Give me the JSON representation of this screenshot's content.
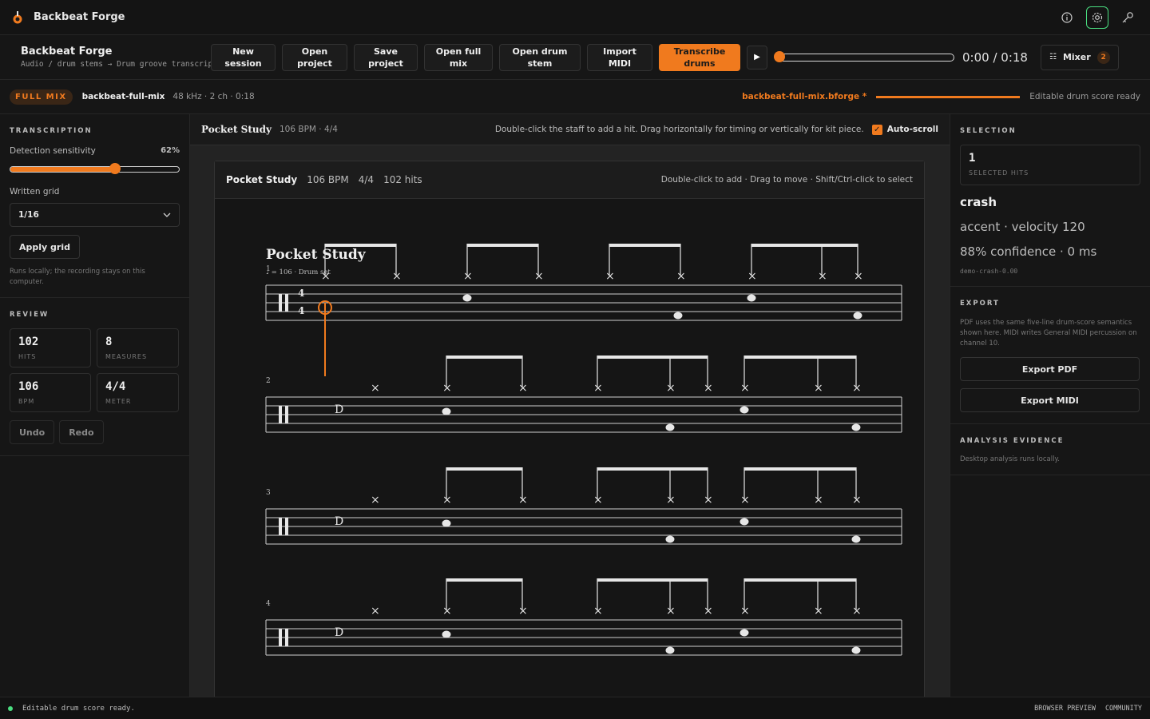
{
  "titlebar": {
    "title": "Backbeat Forge"
  },
  "toolbar": {
    "brand_name": "Backbeat Forge",
    "brand_sub": "Audio / drum stems → Drum groove transcription",
    "buttons": [
      {
        "l1": "New",
        "l2": "session"
      },
      {
        "l1": "Open",
        "l2": "project"
      },
      {
        "l1": "Save",
        "l2": "project"
      },
      {
        "l1": "Open full",
        "l2": "mix"
      },
      {
        "l1": "Open drum",
        "l2": "stem"
      },
      {
        "l1": "Import",
        "l2": "MIDI"
      }
    ],
    "transcribe": {
      "l1": "Transcribe",
      "l2": "drums"
    },
    "play_glyph": "▶",
    "time": "0:00 / 0:18",
    "playback_progress": 0.0,
    "mixer_label": "Mixer",
    "mixer_badge": "2"
  },
  "filebar": {
    "badge": "FULL MIX",
    "file": "backbeat-full-mix",
    "meta": "48 kHz · 2 ch · 0:18",
    "project": "backbeat-full-mix.bforge *",
    "status": "Editable drum score ready"
  },
  "left": {
    "transcription_title": "TRANSCRIPTION",
    "sensitivity_label": "Detection sensitivity",
    "sensitivity_value": "62%",
    "sensitivity": 0.62,
    "grid_label": "Written grid",
    "grid_value": "1/16",
    "apply_grid": "Apply grid",
    "local_note": "Runs locally; the recording stays on this computer.",
    "review_title": "REVIEW",
    "stats": [
      {
        "v": "102",
        "k": "HITS"
      },
      {
        "v": "8",
        "k": "MEASURES"
      },
      {
        "v": "106",
        "k": "BPM"
      },
      {
        "v": "4/4",
        "k": "METER"
      }
    ],
    "undo": "Undo",
    "redo": "Redo"
  },
  "center": {
    "title": "Pocket Study",
    "meta": "106 BPM · 4/4",
    "hint": "Double-click the staff to add a hit. Drag horizontally for timing or vertically for kit piece.",
    "autoscroll": "Auto-scroll",
    "card_title": "Pocket Study",
    "card_bpm": "106 BPM",
    "card_meter": "4/4",
    "card_hits": "102 hits",
    "card_hint": "Double-click to add · Drag to move · Shift/Ctrl-click to select",
    "score_title": "Pocket Study",
    "score_tempo": "♩ = 106 · Drum set",
    "measures": [
      "1",
      "2",
      "3",
      "4"
    ],
    "time_sig_top": "4",
    "time_sig_bottom": "4"
  },
  "right": {
    "selection_title": "SELECTION",
    "selected_count": "1",
    "selected_label": "SELECTED HITS",
    "piece": "crash",
    "detail1": "accent · velocity 120",
    "detail2": "88% confidence · 0 ms",
    "hit_id": "demo-crash-0.00",
    "export_title": "EXPORT",
    "export_note": "PDF uses the same five-line drum-score semantics shown here. MIDI writes General MIDI percussion on channel 10.",
    "export_pdf": "Export PDF",
    "export_midi": "Export MIDI",
    "evidence_title": "ANALYSIS EVIDENCE",
    "evidence_note": "Desktop analysis runs locally."
  },
  "status": {
    "message": "Editable drum score ready.",
    "right1": "BROWSER PREVIEW",
    "right2": "COMMUNITY"
  },
  "colors": {
    "accent": "#f07a1e",
    "ok": "#4ade80"
  }
}
